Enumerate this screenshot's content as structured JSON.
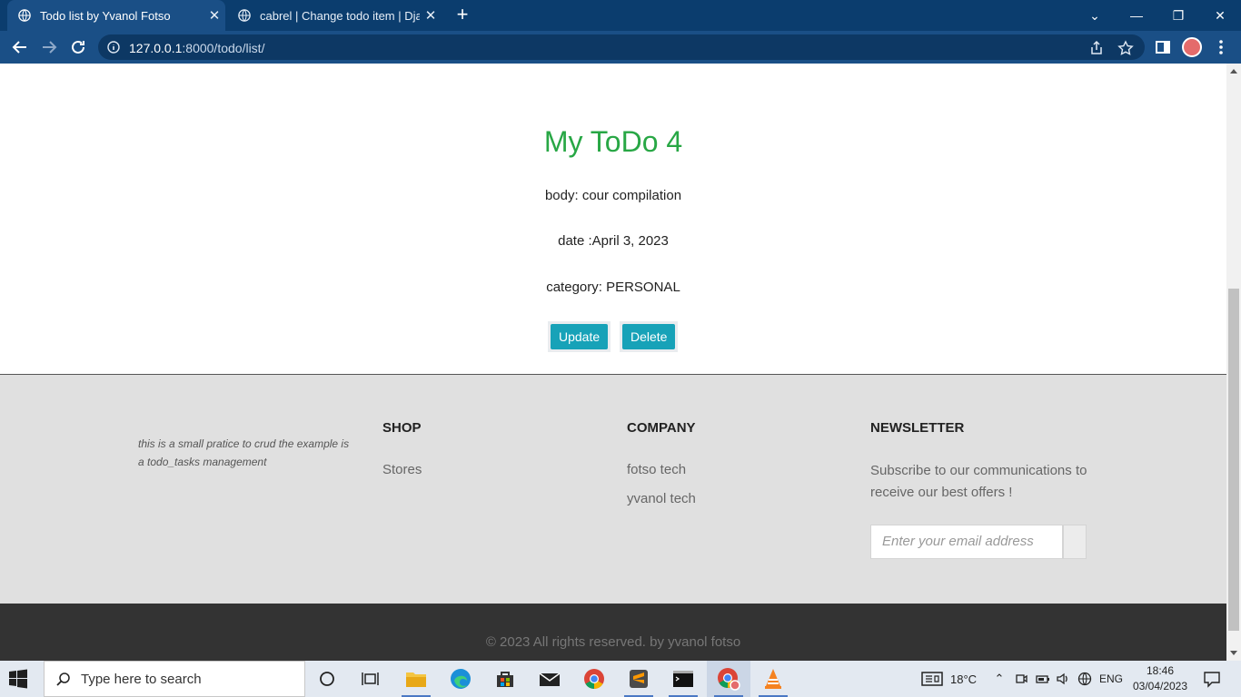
{
  "browser": {
    "tabs": [
      {
        "title": "Todo list by Yvanol Fotso",
        "active": true
      },
      {
        "title": "cabrel | Change todo item | Djang",
        "active": false
      }
    ],
    "url_host": "127.0.0.1",
    "url_rest": ":8000/todo/list/"
  },
  "todo": {
    "title": "My ToDo 4",
    "body": "body: cour compilation",
    "date": "date :April 3, 2023",
    "category": "category: PERSONAL",
    "update_label": "Update",
    "delete_label": "Delete"
  },
  "footer": {
    "about": "this is a small pratice to crud the example is a todo_tasks management",
    "shop": {
      "heading": "SHOP",
      "links": [
        "Stores"
      ]
    },
    "company": {
      "heading": "COMPANY",
      "links": [
        "fotso tech",
        "yvanol tech"
      ]
    },
    "newsletter": {
      "heading": "NEWSLETTER",
      "description": "Subscribe to our communications to receive our best offers !",
      "email_placeholder": "Enter your email address"
    },
    "copyright": "© 2023 All rights reserved. by yvanol fotso"
  },
  "taskbar": {
    "search_placeholder": "Type here to search",
    "weather": "18°C",
    "language": "ENG",
    "time": "18:46",
    "date": "03/04/2023"
  },
  "colors": {
    "title_green": "#28a745",
    "button_teal": "#17a2b8",
    "chrome_dark": "#0b3d6e",
    "footer_light": "#e0e0e0",
    "footer_dark": "#333333"
  }
}
